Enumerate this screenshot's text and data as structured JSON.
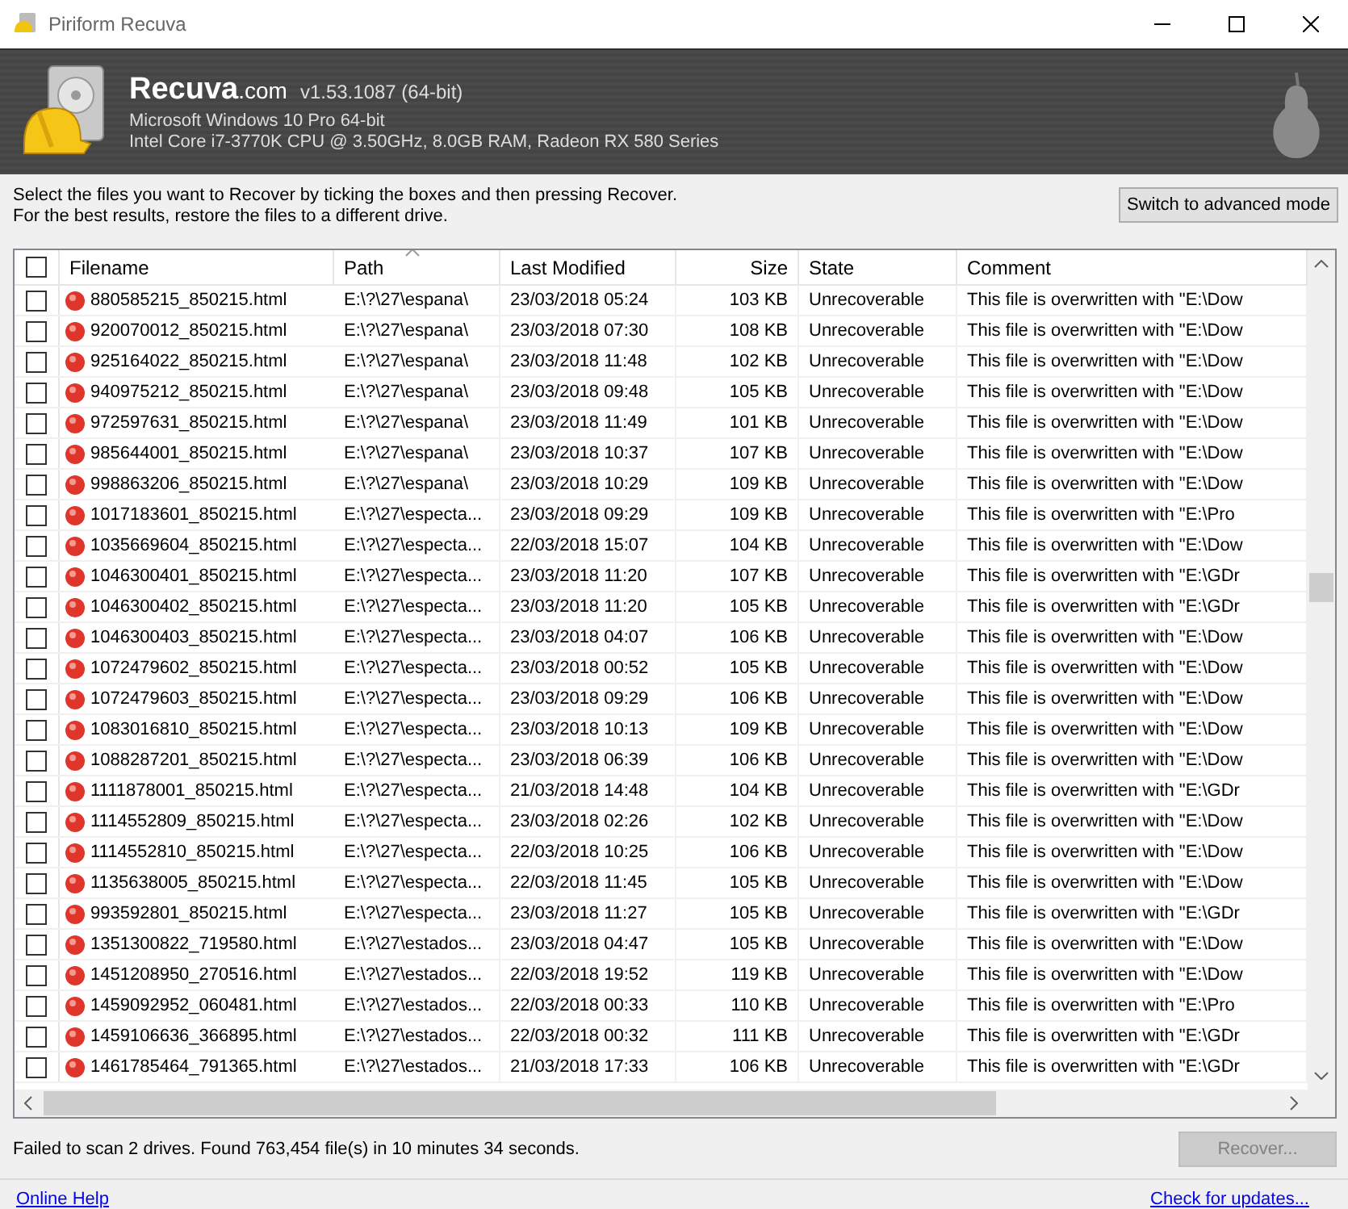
{
  "window": {
    "title": "Piriform Recuva"
  },
  "header": {
    "logo": "**Recuva**.com",
    "version": "v1.53.1087 (64-bit)",
    "os": "Microsoft Windows 10 Pro 64-bit",
    "hardware": "Intel Core i7-3770K CPU @ 3.50GHz, 8.0GB RAM, Radeon RX 580 Series"
  },
  "instructions": [
    "Select the files you want to Recover by ticking the boxes and then pressing Recover.",
    "For the best results, restore the files to a different drive."
  ],
  "advanced_button": "Switch to advanced mode",
  "table": {
    "select_all": {
      "checked": false
    },
    "columns": [
      {
        "label": "Filename",
        "sorted": false
      },
      {
        "label": "Path",
        "sorted": true
      },
      {
        "label": "Last Modified",
        "sorted": false
      },
      {
        "label": "Size",
        "sorted": false
      },
      {
        "label": "State",
        "sorted": false
      },
      {
        "label": "Comment",
        "sorted": false
      }
    ],
    "rows": [
      {
        "checked": false,
        "filename": "880585215_850215.html",
        "path": "E:\\?\\27\\espana\\",
        "modified": "23/03/2018 05:24",
        "size": "103 KB",
        "state": "Unrecoverable",
        "comment": "This file is overwritten with \"E:\\Dow"
      },
      {
        "checked": false,
        "filename": "920070012_850215.html",
        "path": "E:\\?\\27\\espana\\",
        "modified": "23/03/2018 07:30",
        "size": "108 KB",
        "state": "Unrecoverable",
        "comment": "This file is overwritten with \"E:\\Dow"
      },
      {
        "checked": false,
        "filename": "925164022_850215.html",
        "path": "E:\\?\\27\\espana\\",
        "modified": "23/03/2018 11:48",
        "size": "102 KB",
        "state": "Unrecoverable",
        "comment": "This file is overwritten with \"E:\\Dow"
      },
      {
        "checked": false,
        "filename": "940975212_850215.html",
        "path": "E:\\?\\27\\espana\\",
        "modified": "23/03/2018 09:48",
        "size": "105 KB",
        "state": "Unrecoverable",
        "comment": "This file is overwritten with \"E:\\Dow"
      },
      {
        "checked": false,
        "filename": "972597631_850215.html",
        "path": "E:\\?\\27\\espana\\",
        "modified": "23/03/2018 11:49",
        "size": "101 KB",
        "state": "Unrecoverable",
        "comment": "This file is overwritten with \"E:\\Dow"
      },
      {
        "checked": false,
        "filename": "985644001_850215.html",
        "path": "E:\\?\\27\\espana\\",
        "modified": "23/03/2018 10:37",
        "size": "107 KB",
        "state": "Unrecoverable",
        "comment": "This file is overwritten with \"E:\\Dow"
      },
      {
        "checked": false,
        "filename": "998863206_850215.html",
        "path": "E:\\?\\27\\espana\\",
        "modified": "23/03/2018 10:29",
        "size": "109 KB",
        "state": "Unrecoverable",
        "comment": "This file is overwritten with \"E:\\Dow"
      },
      {
        "checked": false,
        "filename": "1017183601_850215.html",
        "path": "E:\\?\\27\\especta...",
        "modified": "23/03/2018 09:29",
        "size": "109 KB",
        "state": "Unrecoverable",
        "comment": "This file is overwritten with \"E:\\Pro"
      },
      {
        "checked": false,
        "filename": "1035669604_850215.html",
        "path": "E:\\?\\27\\especta...",
        "modified": "22/03/2018 15:07",
        "size": "104 KB",
        "state": "Unrecoverable",
        "comment": "This file is overwritten with \"E:\\Dow"
      },
      {
        "checked": false,
        "filename": "1046300401_850215.html",
        "path": "E:\\?\\27\\especta...",
        "modified": "23/03/2018 11:20",
        "size": "107 KB",
        "state": "Unrecoverable",
        "comment": "This file is overwritten with \"E:\\GDr"
      },
      {
        "checked": false,
        "filename": "1046300402_850215.html",
        "path": "E:\\?\\27\\especta...",
        "modified": "23/03/2018 11:20",
        "size": "105 KB",
        "state": "Unrecoverable",
        "comment": "This file is overwritten with \"E:\\GDr"
      },
      {
        "checked": false,
        "filename": "1046300403_850215.html",
        "path": "E:\\?\\27\\especta...",
        "modified": "23/03/2018 04:07",
        "size": "106 KB",
        "state": "Unrecoverable",
        "comment": "This file is overwritten with \"E:\\Dow"
      },
      {
        "checked": false,
        "filename": "1072479602_850215.html",
        "path": "E:\\?\\27\\especta...",
        "modified": "23/03/2018 00:52",
        "size": "105 KB",
        "state": "Unrecoverable",
        "comment": "This file is overwritten with \"E:\\Dow"
      },
      {
        "checked": false,
        "filename": "1072479603_850215.html",
        "path": "E:\\?\\27\\especta...",
        "modified": "23/03/2018 09:29",
        "size": "106 KB",
        "state": "Unrecoverable",
        "comment": "This file is overwritten with \"E:\\Dow"
      },
      {
        "checked": false,
        "filename": "1083016810_850215.html",
        "path": "E:\\?\\27\\especta...",
        "modified": "23/03/2018 10:13",
        "size": "109 KB",
        "state": "Unrecoverable",
        "comment": "This file is overwritten with \"E:\\Dow"
      },
      {
        "checked": false,
        "filename": "1088287201_850215.html",
        "path": "E:\\?\\27\\especta...",
        "modified": "23/03/2018 06:39",
        "size": "106 KB",
        "state": "Unrecoverable",
        "comment": "This file is overwritten with \"E:\\Dow"
      },
      {
        "checked": false,
        "filename": "1111878001_850215.html",
        "path": "E:\\?\\27\\especta...",
        "modified": "21/03/2018 14:48",
        "size": "104 KB",
        "state": "Unrecoverable",
        "comment": "This file is overwritten with \"E:\\GDr"
      },
      {
        "checked": false,
        "filename": "1114552809_850215.html",
        "path": "E:\\?\\27\\especta...",
        "modified": "23/03/2018 02:26",
        "size": "102 KB",
        "state": "Unrecoverable",
        "comment": "This file is overwritten with \"E:\\Dow"
      },
      {
        "checked": false,
        "filename": "1114552810_850215.html",
        "path": "E:\\?\\27\\especta...",
        "modified": "22/03/2018 10:25",
        "size": "106 KB",
        "state": "Unrecoverable",
        "comment": "This file is overwritten with \"E:\\Dow"
      },
      {
        "checked": false,
        "filename": "1135638005_850215.html",
        "path": "E:\\?\\27\\especta...",
        "modified": "22/03/2018 11:45",
        "size": "105 KB",
        "state": "Unrecoverable",
        "comment": "This file is overwritten with \"E:\\Dow"
      },
      {
        "checked": false,
        "filename": "993592801_850215.html",
        "path": "E:\\?\\27\\especta...",
        "modified": "23/03/2018 11:27",
        "size": "105 KB",
        "state": "Unrecoverable",
        "comment": "This file is overwritten with \"E:\\GDr"
      },
      {
        "checked": false,
        "filename": "1351300822_719580.html",
        "path": "E:\\?\\27\\estados...",
        "modified": "23/03/2018 04:47",
        "size": "105 KB",
        "state": "Unrecoverable",
        "comment": "This file is overwritten with \"E:\\Dow"
      },
      {
        "checked": false,
        "filename": "1451208950_270516.html",
        "path": "E:\\?\\27\\estados...",
        "modified": "22/03/2018 19:52",
        "size": "119 KB",
        "state": "Unrecoverable",
        "comment": "This file is overwritten with \"E:\\Dow"
      },
      {
        "checked": false,
        "filename": "1459092952_060481.html",
        "path": "E:\\?\\27\\estados...",
        "modified": "22/03/2018 00:33",
        "size": "110 KB",
        "state": "Unrecoverable",
        "comment": "This file is overwritten with \"E:\\Pro"
      },
      {
        "checked": false,
        "filename": "1459106636_366895.html",
        "path": "E:\\?\\27\\estados...",
        "modified": "22/03/2018 00:32",
        "size": "111 KB",
        "state": "Unrecoverable",
        "comment": "This file is overwritten with \"E:\\GDr"
      },
      {
        "checked": false,
        "filename": "1461785464_791365.html",
        "path": "E:\\?\\27\\estados...",
        "modified": "21/03/2018 17:33",
        "size": "106 KB",
        "state": "Unrecoverable",
        "comment": "This file is overwritten with \"E:\\GDr"
      }
    ]
  },
  "status": "Failed to scan 2 drives. Found 763,454 file(s) in 10 minutes 34 seconds.",
  "recover_button": {
    "label": "Recover...",
    "disabled": true
  },
  "links": [
    "Online Help",
    "Check for updates..."
  ]
}
